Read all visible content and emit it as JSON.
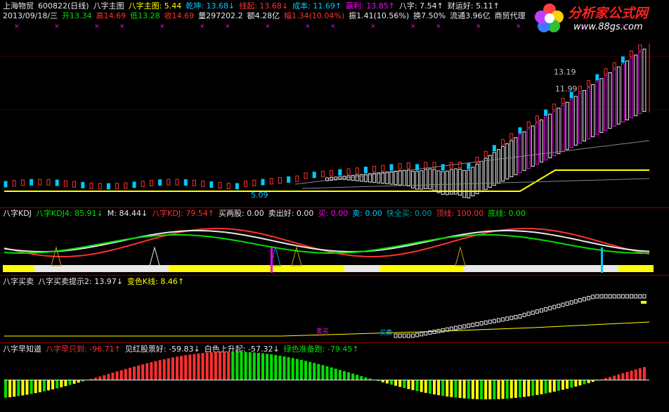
{
  "colors": {
    "white": "#e8e8e8",
    "yellow": "#ffff00",
    "red": "#ff3030",
    "green": "#00e000",
    "cyan": "#00c8ff",
    "magenta": "#ff00ff",
    "teal": "#00a0a0",
    "divider": "#8b0000"
  },
  "main": {
    "stock": "上海物贸",
    "code": "600822(日线)",
    "formula": "八字主图",
    "items": [
      {
        "label": "八字主图: 5.44",
        "color": "yellow"
      },
      {
        "label": "乾坤: 13.68↓",
        "color": "cyan"
      },
      {
        "label": "线起: 13.68↓",
        "color": "red"
      },
      {
        "label": "成本: 11.69↑",
        "color": "cyan"
      },
      {
        "label": "赢利: 13.85↑",
        "color": "magenta"
      },
      {
        "label": "八字: 7.54↑",
        "color": "white"
      },
      {
        "label": "财运好: 5.11↑",
        "color": "white"
      }
    ],
    "quote": [
      {
        "label": "2013/09/18/三",
        "color": "white"
      },
      {
        "label": "开13.34",
        "color": "green"
      },
      {
        "label": "高14.69",
        "color": "red"
      },
      {
        "label": "低13.28",
        "color": "green"
      },
      {
        "label": "收14.69",
        "color": "red"
      },
      {
        "label": "量297202.2",
        "color": "white"
      },
      {
        "label": "额4.28亿",
        "color": "white"
      },
      {
        "label": "幅1.34(10.04%)",
        "color": "red"
      },
      {
        "label": "振1.41(10.56%)",
        "color": "white"
      },
      {
        "label": "换7.50%",
        "color": "white"
      },
      {
        "label": "流通3.96亿",
        "color": "white"
      },
      {
        "label": "商贸代理",
        "color": "white"
      }
    ],
    "price_labels": {
      "high_a": "13.19",
      "high_b": "11.99",
      "low": "5.09"
    }
  },
  "kdj": {
    "name": "八字KDJ",
    "items": [
      {
        "label": "八字KDJ4: 85.91↓",
        "color": "green"
      },
      {
        "label": "M: 84.44↓",
        "color": "white"
      },
      {
        "label": "八字KDJ: 79.54↑",
        "color": "red"
      },
      {
        "label": "买两股: 0.00",
        "color": "white"
      },
      {
        "label": "卖出好: 0.00",
        "color": "white"
      },
      {
        "label": "买: 0.00",
        "color": "magenta"
      },
      {
        "label": "卖: 0.00",
        "color": "cyan"
      },
      {
        "label": "快全买: 0.00",
        "color": "teal"
      },
      {
        "label": "顶线: 100.00",
        "color": "red"
      },
      {
        "label": "底线: 0.00",
        "color": "green"
      }
    ]
  },
  "trade": {
    "name": "八字买卖",
    "items": [
      {
        "label": "八字买卖提示2: 13.97↓",
        "color": "white"
      },
      {
        "label": "变色K线: 8.46↑",
        "color": "yellow"
      }
    ]
  },
  "early": {
    "name": "八字早知道",
    "items": [
      {
        "label": "八字早只到: -96.71↑",
        "color": "red"
      },
      {
        "label": "见红股票好: -59.83↓",
        "color": "white"
      },
      {
        "label": "白色上升起: -57.32↓",
        "color": "white"
      },
      {
        "label": "绿色准备跑: -79.45↑",
        "color": "green"
      }
    ]
  },
  "logo": {
    "title": "分析家公式网",
    "url": "www.88gs.com"
  }
}
